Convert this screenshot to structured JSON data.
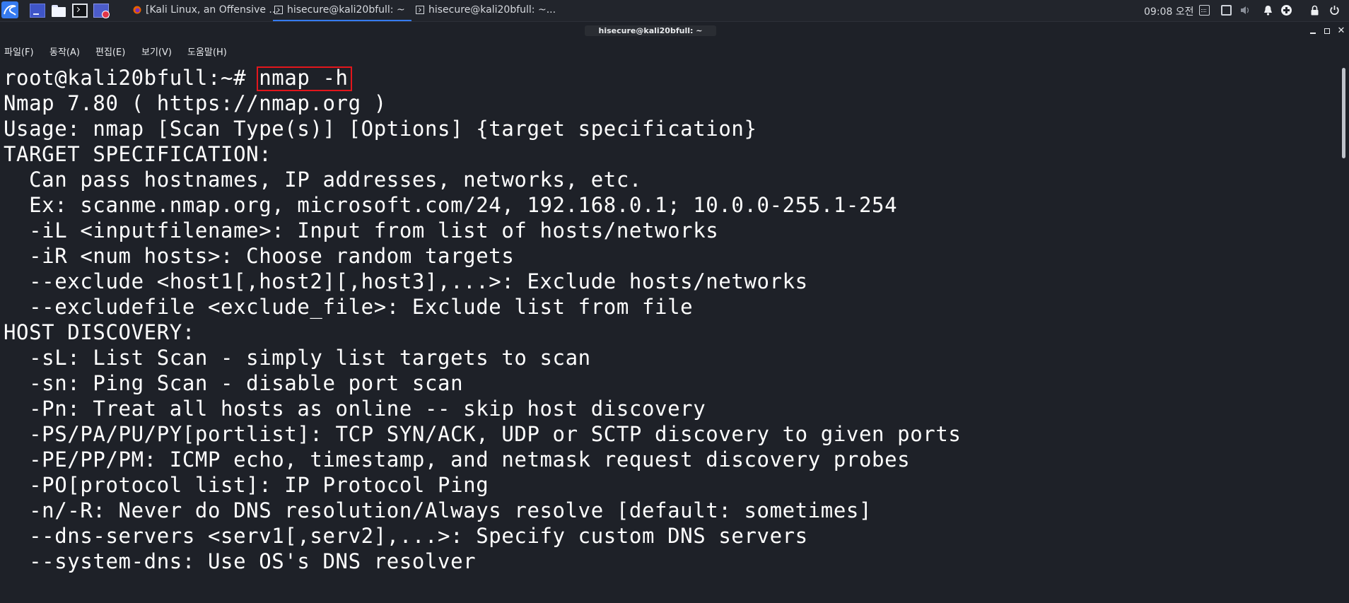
{
  "panel": {
    "icons": [
      "kali-dragon-icon",
      "show-desktop-icon",
      "file-manager-icon",
      "terminal-icon",
      "screen-recorder-icon"
    ],
    "tasks": [
      {
        "label": "[Kali Linux, an Offensive ...",
        "icon": "firefox-icon",
        "active": false
      },
      {
        "label": "hisecure@kali20bfull: ~",
        "icon": "terminal-icon",
        "active": true
      },
      {
        "label": "hisecure@kali20bfull: ~...",
        "icon": "terminal-icon",
        "active": false
      }
    ],
    "clock": "09:08 오전",
    "tray": [
      "keyboard-icon",
      "display-icon",
      "volume-muted-icon",
      "notification-bell-icon",
      "add-icon",
      "lock-icon",
      "power-icon"
    ]
  },
  "window": {
    "title": "hisecure@kali20bfull: ~",
    "controls": [
      "minimize-icon",
      "maximize-icon",
      "close-icon"
    ]
  },
  "menu": [
    "파일(F)",
    "동작(A)",
    "편집(E)",
    "보기(V)",
    "도움말(H)"
  ],
  "terminal": {
    "prompt": "root@kali20bfull:~# ",
    "command": "nmap -h",
    "lines": [
      "Nmap 7.80 ( https://nmap.org )",
      "Usage: nmap [Scan Type(s)] [Options] {target specification}",
      "TARGET SPECIFICATION:",
      "  Can pass hostnames, IP addresses, networks, etc.",
      "  Ex: scanme.nmap.org, microsoft.com/24, 192.168.0.1; 10.0.0-255.1-254",
      "  -iL <inputfilename>: Input from list of hosts/networks",
      "  -iR <num hosts>: Choose random targets",
      "  --exclude <host1[,host2][,host3],...>: Exclude hosts/networks",
      "  --excludefile <exclude_file>: Exclude list from file",
      "HOST DISCOVERY:",
      "  -sL: List Scan - simply list targets to scan",
      "  -sn: Ping Scan - disable port scan",
      "  -Pn: Treat all hosts as online -- skip host discovery",
      "  -PS/PA/PU/PY[portlist]: TCP SYN/ACK, UDP or SCTP discovery to given ports",
      "  -PE/PP/PM: ICMP echo, timestamp, and netmask request discovery probes",
      "  -PO[protocol list]: IP Protocol Ping",
      "  -n/-R: Never do DNS resolution/Always resolve [default: sometimes]",
      "  --dns-servers <serv1[,serv2],...>: Specify custom DNS servers",
      "  --system-dns: Use OS's DNS resolver"
    ]
  },
  "colors": {
    "background": "#1e2128",
    "panel": "#22252c",
    "text": "#ffffff",
    "highlight_box": "#e3161c",
    "active_task": "#367bf0"
  }
}
